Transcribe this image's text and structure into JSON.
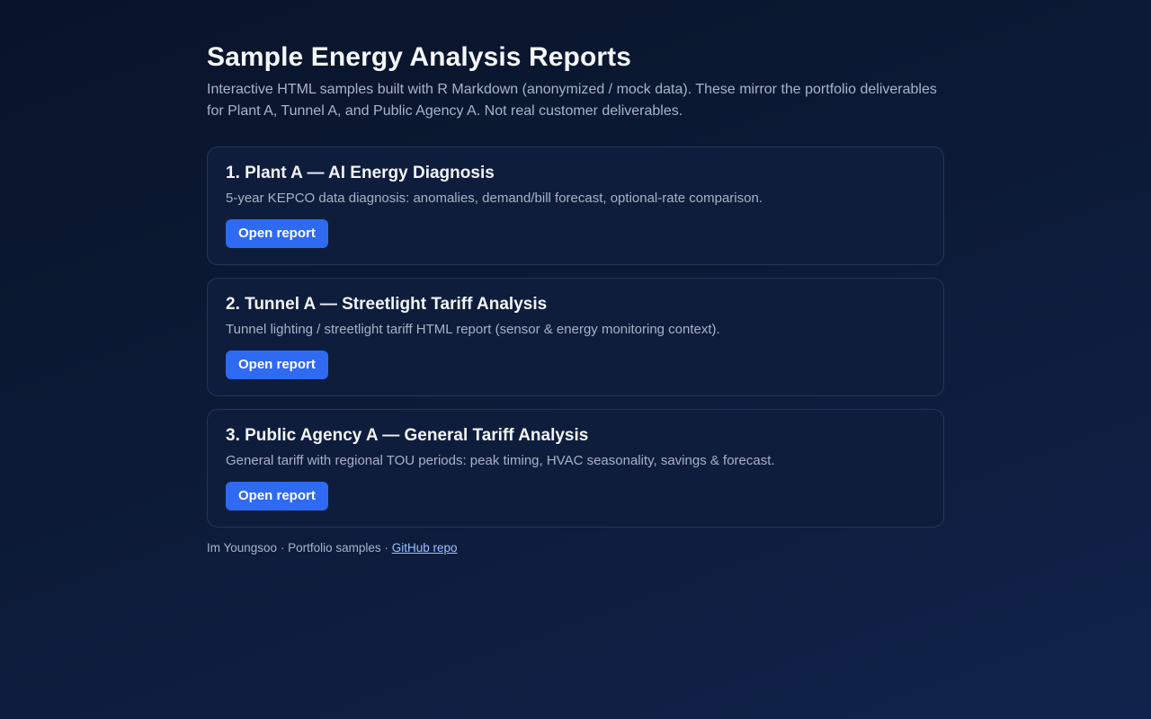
{
  "header": {
    "title": "Sample Energy Analysis Reports",
    "subtitle": "Interactive HTML samples built with R Markdown (anonymized / mock data). These mirror the portfolio deliverables for Plant A, Tunnel A, and Public Agency A. Not real customer deliverables."
  },
  "reports": [
    {
      "title": "1. Plant A — AI Energy Diagnosis",
      "description": "5-year KEPCO data diagnosis: anomalies, demand/bill forecast, optional-rate comparison.",
      "button_label": "Open report"
    },
    {
      "title": "2. Tunnel A — Streetlight Tariff Analysis",
      "description": "Tunnel lighting / streetlight tariff HTML report (sensor & energy monitoring context).",
      "button_label": "Open report"
    },
    {
      "title": "3. Public Agency A — General Tariff Analysis",
      "description": "General tariff with regional TOU periods: peak timing, HVAC seasonality, savings & forecast.",
      "button_label": "Open report"
    }
  ],
  "footer": {
    "author": "Im Youngsoo",
    "separator": "·",
    "label": "Portfolio samples",
    "link_text": "GitHub repo"
  },
  "colors": {
    "background": "#0c1a36",
    "card": "#0f1d3c",
    "button": "#2e6af2",
    "link": "#9cc0ff"
  }
}
